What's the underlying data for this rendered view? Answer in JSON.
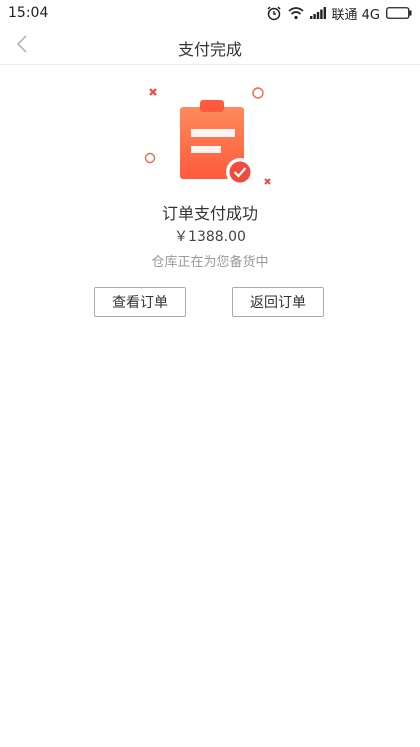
{
  "status_bar": {
    "time": "15:04",
    "carrier": "联通 4G",
    "icons": [
      "alarm-icon",
      "wifi-icon",
      "signal-icon",
      "battery-icon"
    ]
  },
  "nav": {
    "title": "支付完成",
    "back_icon": "chevron-left-icon"
  },
  "result": {
    "illustration": "clipboard-check-illustration",
    "title": "订单支付成功",
    "amount": "￥1388.00",
    "hint": "仓库正在为您备货中"
  },
  "actions": {
    "view_order": "查看订单",
    "return_order": "返回订单"
  },
  "colors": {
    "accent_orange": "#ff6a3d",
    "accent_light": "#ff8a5b",
    "check_bg": "#ffffff"
  }
}
